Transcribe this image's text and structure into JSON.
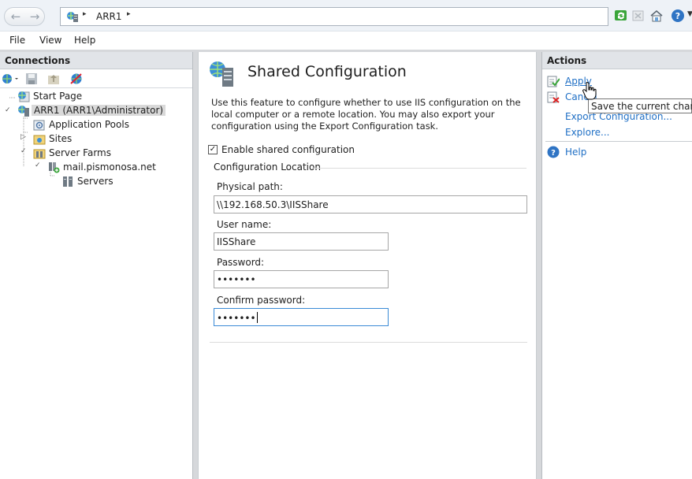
{
  "address_bar": {
    "crumb": "ARR1",
    "separator": "▸",
    "back_icon": "back-arrow-icon",
    "forward_icon": "forward-arrow-icon"
  },
  "menu": [
    "File",
    "View",
    "Help"
  ],
  "connections": {
    "header": "Connections",
    "tree": {
      "start_page": "Start Page",
      "server": "ARR1 (ARR1\\Administrator)",
      "app_pools": "Application Pools",
      "sites": "Sites",
      "server_farms": "Server Farms",
      "farm": "mail.pismonosa.net",
      "servers": "Servers"
    }
  },
  "main": {
    "title": "Shared Configuration",
    "description": "Use this feature to configure whether to use IIS configuration on the local computer or a remote location. You may also export your configuration using the Export Configuration task.",
    "enable_label": "Enable shared configuration",
    "enable_checked": true,
    "group_title": "Configuration Location",
    "physical_path_label": "Physical path:",
    "physical_path_value": "\\\\192.168.50.3\\IISShare",
    "username_label": "User name:",
    "username_value": "IISShare",
    "password_label": "Password:",
    "password_value": "•••••••",
    "confirm_label": "Confirm password:",
    "confirm_value": "•••••••"
  },
  "actions": {
    "header": "Actions",
    "apply": "Apply",
    "cancel": "Cancel",
    "export": "Export Configuration...",
    "explore": "Explore...",
    "help": "Help",
    "tooltip": "Save the current change"
  },
  "colors": {
    "link": "#1f6fc5",
    "header_bg": "#e1e4e8",
    "selection": "#d9d9d9"
  }
}
